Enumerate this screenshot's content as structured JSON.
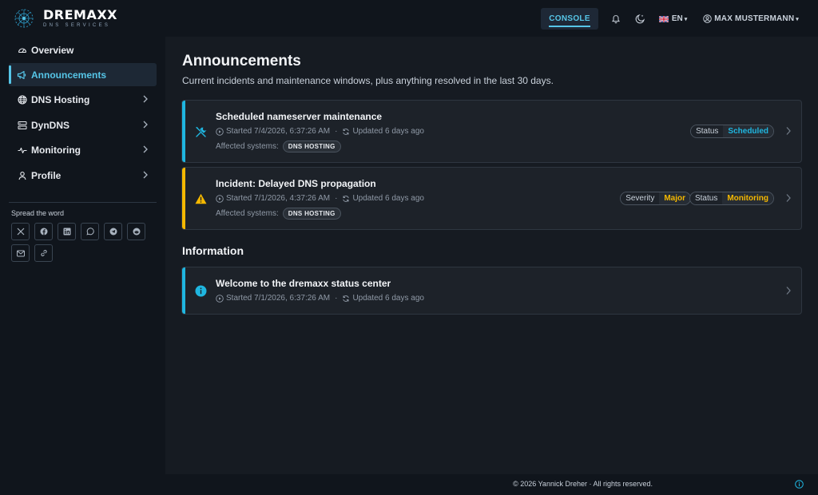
{
  "brand": {
    "name": "DREMAXX",
    "sub": "DNS SERVICES"
  },
  "header": {
    "console_label": "CONSOLE",
    "language": "EN",
    "user_name": "MAX MUSTERMANN"
  },
  "sidebar": {
    "items": [
      {
        "label": "Overview",
        "icon": "speedometer-icon"
      },
      {
        "label": "Announcements",
        "icon": "megaphone-icon"
      },
      {
        "label": "DNS Hosting",
        "icon": "globe-icon"
      },
      {
        "label": "DynDNS",
        "icon": "server-icon"
      },
      {
        "label": "Monitoring",
        "icon": "activity-icon"
      },
      {
        "label": "Profile",
        "icon": "person-icon"
      }
    ],
    "spread_label": "Spread the word",
    "share": [
      "x-icon",
      "facebook-icon",
      "linkedin-icon",
      "whatsapp-icon",
      "telegram-icon",
      "reddit-icon",
      "email-icon",
      "link-icon"
    ]
  },
  "page": {
    "title": "Announcements",
    "subtitle": "Current incidents and maintenance windows, plus anything resolved in the last 30 days.",
    "information_title": "Information"
  },
  "announcements": [
    {
      "title": "Scheduled nameserver maintenance",
      "started": "Started 7/4/2026, 6:37:26 AM",
      "updated": "Updated 6 days ago",
      "affected_label": "Affected systems:",
      "system": "DNS HOSTING",
      "status_key": "Status",
      "status_value": "Scheduled",
      "accent": "#1fb6e0"
    },
    {
      "title": "Incident: Delayed DNS propagation",
      "started": "Started 7/1/2026, 4:37:26 AM",
      "updated": "Updated 6 days ago",
      "affected_label": "Affected systems:",
      "system": "DNS HOSTING",
      "severity_key": "Severity",
      "severity_value": "Major",
      "status_key": "Status",
      "status_value": "Monitoring",
      "accent": "#f5b800"
    }
  ],
  "information": [
    {
      "title": "Welcome to the dremaxx status center",
      "started": "Started 7/1/2026, 6:37:26 AM",
      "updated": "Updated 6 days ago",
      "accent": "#1fb6e0"
    }
  ],
  "footer": {
    "text": "© 2026 Yannick Dreher · All rights reserved."
  }
}
